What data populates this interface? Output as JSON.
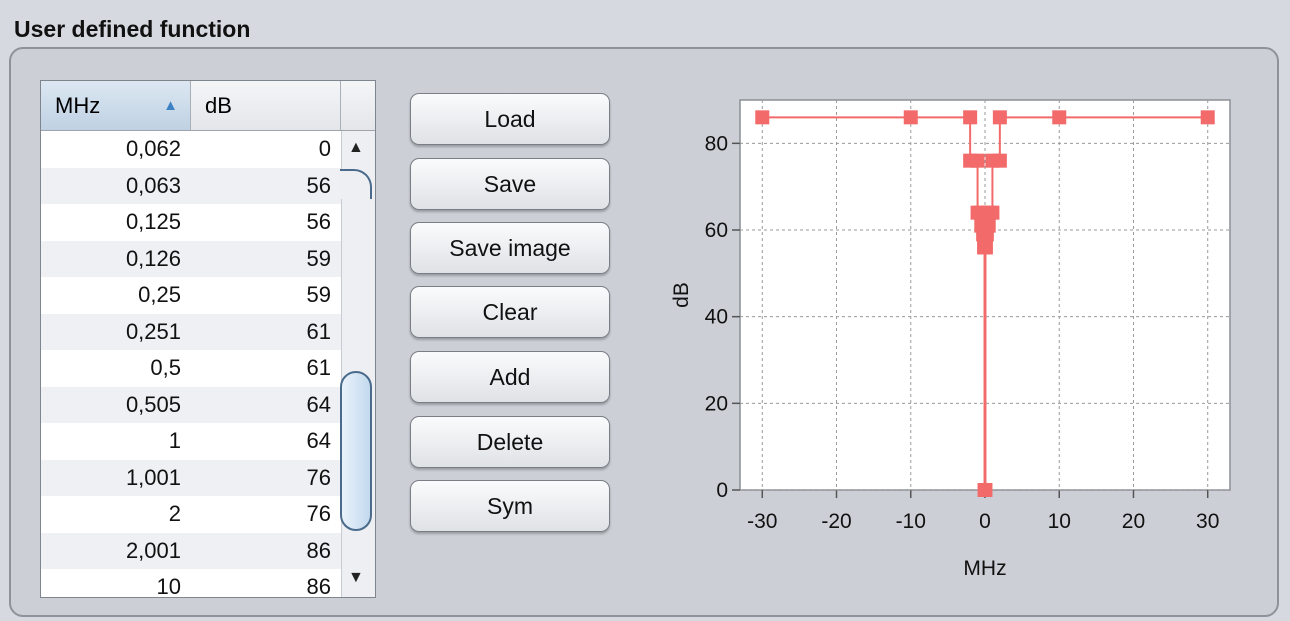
{
  "title": "User defined function",
  "table": {
    "headers": {
      "mhz": "MHz",
      "db": "dB"
    },
    "sort_indicator": "▲",
    "rows": [
      [
        "0,062",
        "0"
      ],
      [
        "0,063",
        "56"
      ],
      [
        "0,125",
        "56"
      ],
      [
        "0,126",
        "59"
      ],
      [
        "0,25",
        "59"
      ],
      [
        "0,251",
        "61"
      ],
      [
        "0,5",
        "61"
      ],
      [
        "0,505",
        "64"
      ],
      [
        "1",
        "64"
      ],
      [
        "1,001",
        "76"
      ],
      [
        "2",
        "76"
      ],
      [
        "2,001",
        "86"
      ],
      [
        "10",
        "86"
      ]
    ],
    "scroll_up": "▲",
    "scroll_down": "▼"
  },
  "buttons": {
    "load": "Load",
    "save": "Save",
    "save_image": "Save image",
    "clear": "Clear",
    "add": "Add",
    "delete": "Delete",
    "sym": "Sym"
  },
  "chart_data": {
    "type": "line",
    "xlabel": "MHz",
    "ylabel": "dB",
    "xlim": [
      -33,
      33
    ],
    "ylim": [
      0,
      90
    ],
    "xticks": [
      "-30",
      "-20",
      "-10",
      "0",
      "10",
      "20",
      "30"
    ],
    "yticks": [
      "0",
      "20",
      "40",
      "60",
      "80"
    ],
    "grid": true,
    "color": "#f26a6a",
    "series": [
      {
        "x": [
          -30,
          -10,
          -2.001,
          -2,
          -1.001,
          -1,
          -0.505,
          -0.5,
          -0.251,
          -0.25,
          -0.126,
          -0.125,
          -0.063,
          -0.062,
          0.062,
          0.063,
          0.125,
          0.126,
          0.25,
          0.251,
          0.5,
          0.505,
          1,
          1.001,
          2,
          2.001,
          10,
          30
        ],
        "y": [
          86,
          86,
          86,
          76,
          76,
          64,
          64,
          61,
          61,
          59,
          59,
          56,
          56,
          0,
          0,
          56,
          56,
          59,
          59,
          61,
          61,
          64,
          64,
          76,
          76,
          86,
          86,
          86
        ]
      }
    ]
  }
}
